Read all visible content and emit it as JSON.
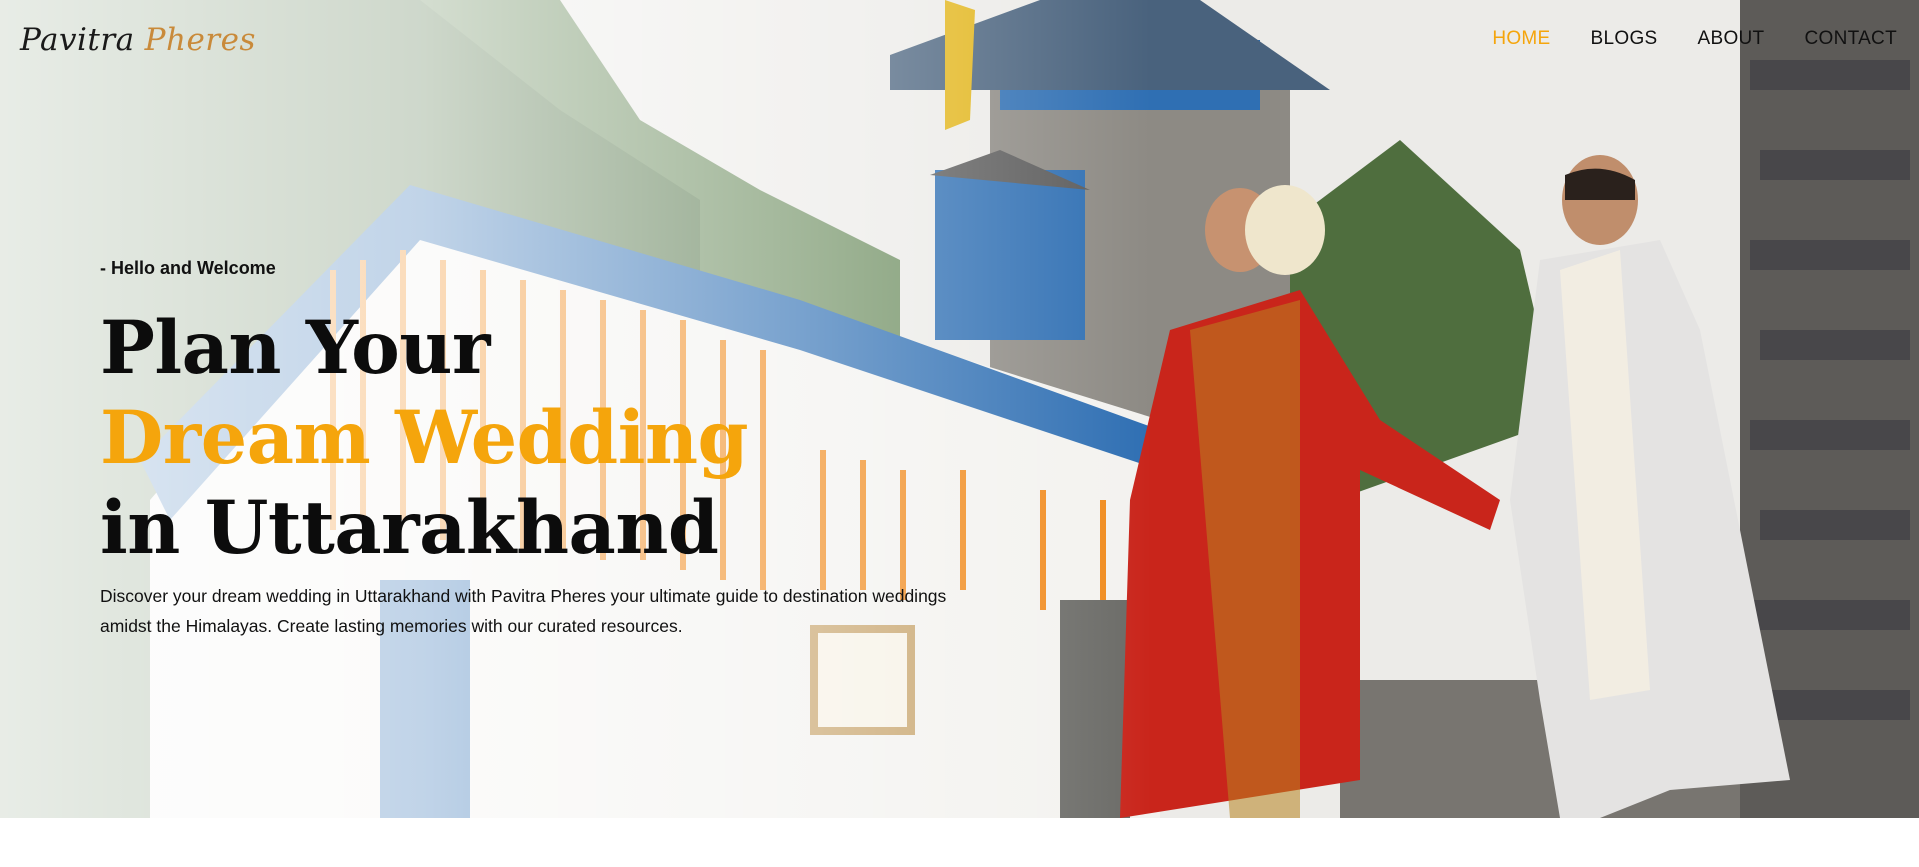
{
  "brand": {
    "part1": "Pavitra",
    "part2": "Pheres"
  },
  "nav": {
    "items": [
      {
        "label": "HOME",
        "active": true
      },
      {
        "label": "BLOGS",
        "active": false
      },
      {
        "label": "ABOUT",
        "active": false
      },
      {
        "label": "CONTACT",
        "active": false
      }
    ]
  },
  "hero": {
    "welcome": "- Hello and Welcome",
    "title_line1": "Plan Your",
    "title_line2": "Dream Wedding",
    "title_line3": "in Uttarakhand",
    "description": "Discover your dream wedding in Uttarakhand with Pavitra Pheres your ultimate guide to destination weddings amidst the Himalayas. Create lasting memories with our curated resources."
  },
  "colors": {
    "accent": "#f5a50c",
    "text": "#111111",
    "logo_accent": "#c98a3a"
  }
}
